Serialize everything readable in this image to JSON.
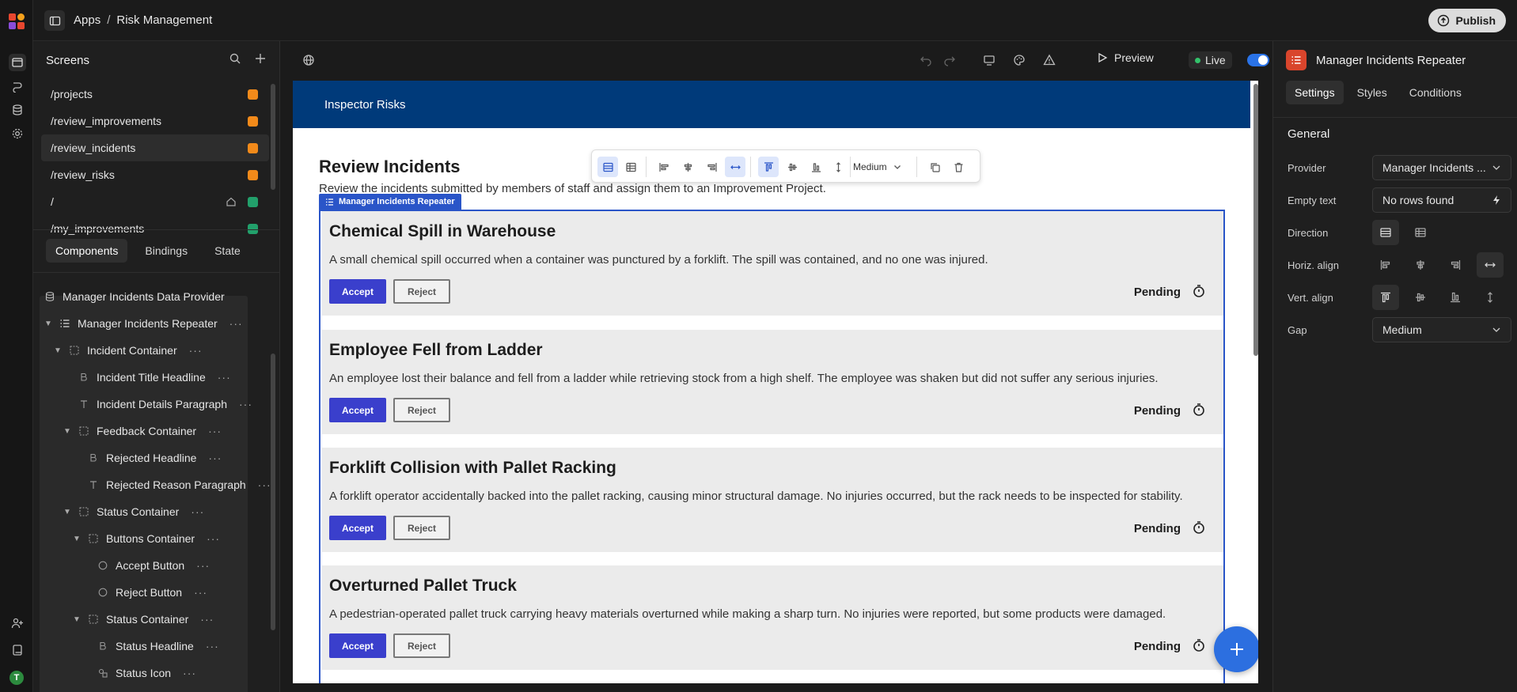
{
  "breadcrumb": {
    "root": "Apps",
    "separator": "/",
    "current": "Risk Management"
  },
  "publish_label": "Publish",
  "screens_panel": {
    "title": "Screens",
    "items": [
      {
        "path": "/projects",
        "color": "#f28a1a",
        "home": false
      },
      {
        "path": "/review_improvements",
        "color": "#f28a1a",
        "home": false
      },
      {
        "path": "/review_incidents",
        "color": "#f28a1a",
        "home": false,
        "active": true
      },
      {
        "path": "/review_risks",
        "color": "#f28a1a",
        "home": false
      },
      {
        "path": "/",
        "color": "#22a06b",
        "home": true
      },
      {
        "path": "/my_improvements",
        "color": "#22a06b",
        "home": false
      }
    ]
  },
  "left_tabs": [
    "Components",
    "Bindings",
    "State"
  ],
  "tree": [
    {
      "label": "Manager Incidents Data Provider",
      "icon": "database-icon",
      "depth": 0,
      "caret": false
    },
    {
      "label": "Manager Incidents Repeater",
      "icon": "list-icon",
      "depth": 0,
      "caret": true
    },
    {
      "label": "Incident Container",
      "icon": "container-icon",
      "depth": 1,
      "caret": true
    },
    {
      "label": "Incident Title Headline",
      "icon": "bold-icon",
      "depth": 2,
      "caret": false
    },
    {
      "label": "Incident Details Paragraph",
      "icon": "text-icon",
      "depth": 2,
      "caret": false
    },
    {
      "label": "Feedback Container",
      "icon": "container-icon",
      "depth": 2,
      "caret": true
    },
    {
      "label": "Rejected Headline",
      "icon": "bold-icon",
      "depth": 3,
      "caret": false
    },
    {
      "label": "Rejected Reason Paragraph",
      "icon": "text-icon",
      "depth": 3,
      "caret": false
    },
    {
      "label": "Status Container",
      "icon": "container-icon",
      "depth": 2,
      "caret": true
    },
    {
      "label": "Buttons Container",
      "icon": "container-icon",
      "depth": 3,
      "caret": true
    },
    {
      "label": "Accept Button",
      "icon": "circle-icon",
      "depth": 4,
      "caret": false
    },
    {
      "label": "Reject Button",
      "icon": "circle-icon",
      "depth": 4,
      "caret": false
    },
    {
      "label": "Status Container",
      "icon": "container-icon",
      "depth": 3,
      "caret": true
    },
    {
      "label": "Status Headline",
      "icon": "bold-icon",
      "depth": 4,
      "caret": false
    },
    {
      "label": "Status Icon",
      "icon": "shapes-icon",
      "depth": 4,
      "caret": false
    }
  ],
  "canvas_toolbar": {
    "preview_label": "Preview",
    "live_label": "Live"
  },
  "app": {
    "header_title": "Inspector Risks",
    "page_title": "Review Incidents",
    "page_description": "Review the incidents submitted by members of staff and assign them to an Improvement Project.",
    "selection_tag": "Manager Incidents Repeater",
    "floating_toolbar_gap": "Medium",
    "incidents": [
      {
        "title": "Chemical Spill in Warehouse",
        "details": "A small chemical spill occurred when a container was punctured by a forklift. The spill was contained, and no one was injured.",
        "accept": "Accept",
        "reject": "Reject",
        "status": "Pending"
      },
      {
        "title": "Employee Fell from Ladder",
        "details": "An employee lost their balance and fell from a ladder while retrieving stock from a high shelf. The employee was shaken but did not suffer any serious injuries.",
        "accept": "Accept",
        "reject": "Reject",
        "status": "Pending"
      },
      {
        "title": "Forklift Collision with Pallet Racking",
        "details": "A forklift operator accidentally backed into the pallet racking, causing minor structural damage. No injuries occurred, but the rack needs to be inspected for stability.",
        "accept": "Accept",
        "reject": "Reject",
        "status": "Pending"
      },
      {
        "title": "Overturned Pallet Truck",
        "details": "A pedestrian-operated pallet truck carrying heavy materials overturned while making a sharp turn. No injuries were reported, but some products were damaged.",
        "accept": "Accept",
        "reject": "Reject",
        "status": "Pending"
      }
    ]
  },
  "right_panel": {
    "title": "Manager Incidents Repeater",
    "tabs": [
      "Settings",
      "Styles",
      "Conditions"
    ],
    "section": "General",
    "provider_label": "Provider",
    "provider_value": "Manager Incidents ...",
    "empty_text_label": "Empty text",
    "empty_text_value": "No rows found",
    "direction_label": "Direction",
    "horiz_align_label": "Horiz. align",
    "vert_align_label": "Vert. align",
    "gap_label": "Gap",
    "gap_value": "Medium"
  },
  "colors": {
    "accent": "#2a55c8",
    "header": "#003a7a",
    "accept": "#3a3fcc",
    "fab": "#2c6fe0",
    "live": "#33c26b"
  }
}
